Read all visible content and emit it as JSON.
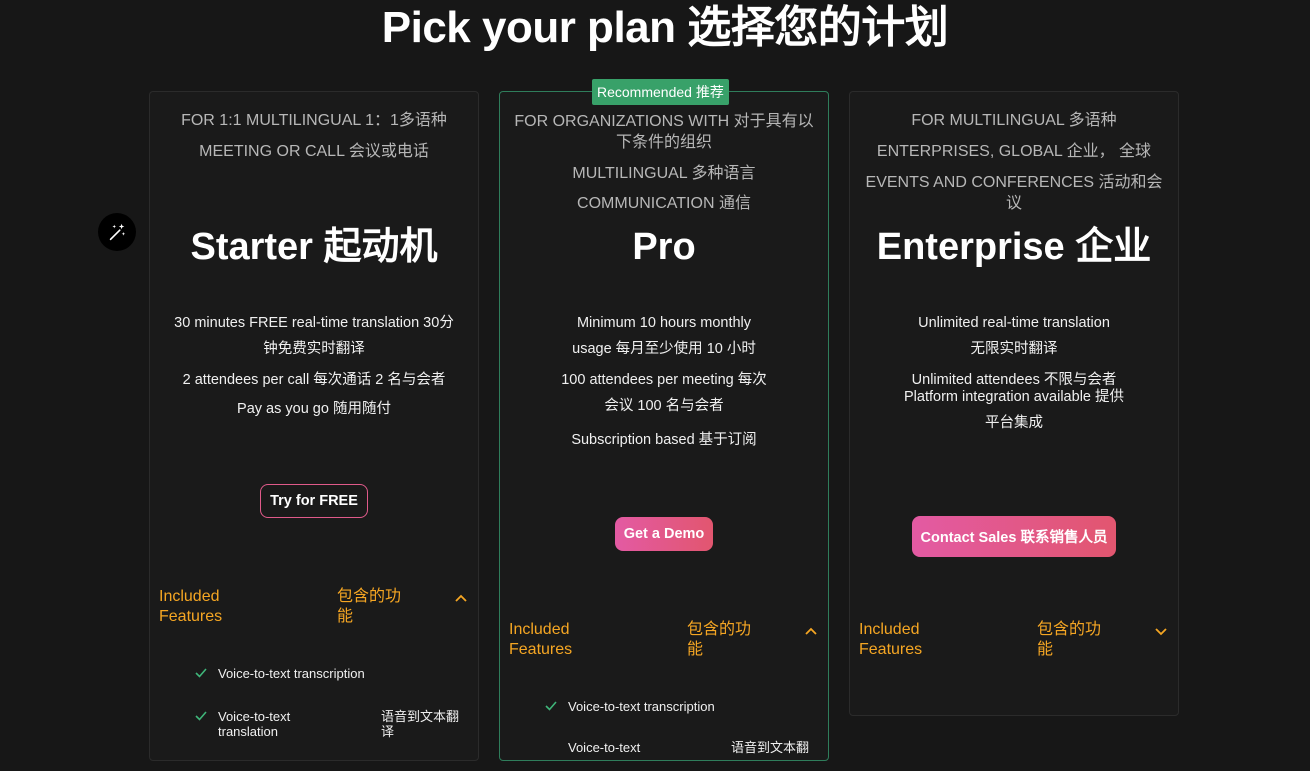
{
  "title": "Pick your plan 选择您的计划",
  "included_label_en": "Included Features",
  "included_label_zh": "包含的功能",
  "plans": {
    "starter": {
      "audience": [
        "FOR 1:1 MULTILINGUAL 1：1多语种",
        "MEETING OR CALL 会议或电话"
      ],
      "name": "Starter 起动机",
      "features": [
        "30 minutes FREE real-time translation 30分钟免费实时翻译",
        "2 attendees per call 每次通话 2 名与会者",
        "Pay as you go 随用随付"
      ],
      "cta": "Try for FREE",
      "list": [
        {
          "en": "Voice-to-text transcription",
          "zh": ""
        },
        {
          "en": "Voice-to-text translation",
          "zh": "语音到文本翻译"
        }
      ]
    },
    "pro": {
      "badge": "Recommended 推荐",
      "audience": [
        "FOR ORGANIZATIONS WITH 对于具有以下条件的组织",
        "MULTILINGUAL 多种语言",
        "COMMUNICATION 通信"
      ],
      "name": "Pro",
      "features": [
        "Minimum 10 hours monthly usage 每月至少使用 10 小时",
        "100 attendees per meeting 每次会议 100 名与会者",
        "Subscription based 基于订阅"
      ],
      "cta": "Get a Demo",
      "list": [
        {
          "en": "Voice-to-text transcription",
          "zh": ""
        },
        {
          "en": "Voice-to-text",
          "zh": "语音到文本翻"
        }
      ]
    },
    "enterprise": {
      "audience": [
        "FOR MULTILINGUAL 多语种",
        "ENTERPRISES, GLOBAL 企业， 全球",
        "EVENTS AND CONFERENCES 活动和会议"
      ],
      "name": "Enterprise 企业",
      "features": [
        "Unlimited real-time translation 无限实时翻译",
        "Unlimited attendees 不限与会者",
        "Platform integration available 提供平台集成"
      ],
      "cta": "Contact Sales 联系销售人员"
    }
  },
  "colors": {
    "background": "#171717",
    "accent_orange": "#f5a623",
    "recommended_green": "#38a169",
    "cta_pink": "#e35aa3",
    "check_green": "#3fb67a"
  },
  "icons": {
    "magic": "magic-wand-sparkles-icon",
    "expanded": "chevron-up-icon",
    "collapsed": "chevron-down-icon",
    "check": "check-icon"
  }
}
